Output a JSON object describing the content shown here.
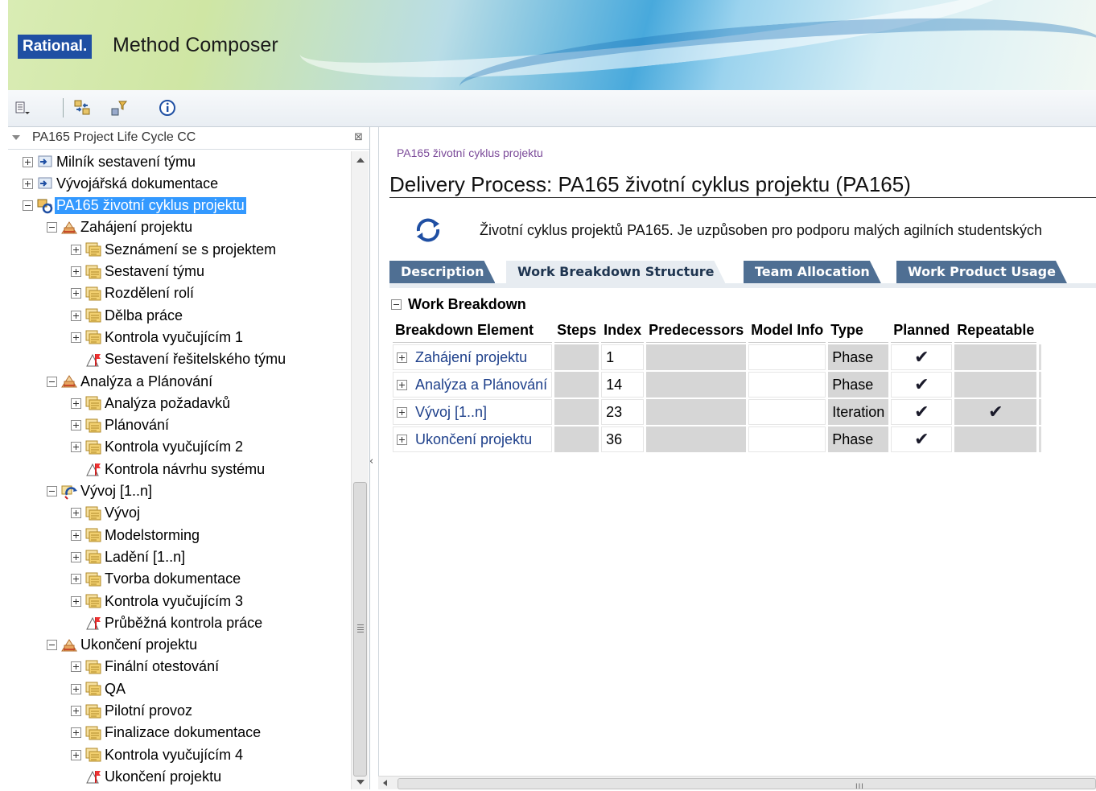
{
  "app": {
    "brand_badge": "Rational.",
    "product_name": "Method Composer"
  },
  "toolbar": {
    "buttons": [
      {
        "name": "view-menu-icon"
      },
      {
        "name": "link-with-editor-icon"
      },
      {
        "name": "filter-icon"
      },
      {
        "name": "info-icon"
      }
    ]
  },
  "library": {
    "title": "PA165 Project Life Cycle CC",
    "close_glyph": "⊠",
    "tree": [
      {
        "label": "Milník sestavení týmu",
        "level": 0,
        "type": "milestone",
        "expander": "plus"
      },
      {
        "label": "Vývojářská dokumentace",
        "level": 0,
        "type": "milestone",
        "expander": "plus"
      },
      {
        "label": "PA165 životní cyklus projektu",
        "level": 0,
        "type": "process",
        "expander": "minus",
        "selected": true
      },
      {
        "label": "Zahájení projektu",
        "level": 1,
        "type": "phase",
        "expander": "minus"
      },
      {
        "label": "Seznámení se s projektem",
        "level": 2,
        "type": "activity",
        "expander": "plus"
      },
      {
        "label": "Sestavení týmu",
        "level": 2,
        "type": "activity",
        "expander": "plus"
      },
      {
        "label": "Rozdělení rolí",
        "level": 2,
        "type": "activity",
        "expander": "plus"
      },
      {
        "label": "Dělba práce",
        "level": 2,
        "type": "activity",
        "expander": "plus"
      },
      {
        "label": "Kontrola vyučujícím 1",
        "level": 2,
        "type": "activity",
        "expander": "plus"
      },
      {
        "label": "Sestavení řešitelského týmu",
        "level": 2,
        "type": "milestone-flag",
        "expander": "none"
      },
      {
        "label": "Analýza a Plánování",
        "level": 1,
        "type": "phase",
        "expander": "minus"
      },
      {
        "label": "Analýza požadavků",
        "level": 2,
        "type": "activity",
        "expander": "plus"
      },
      {
        "label": "Plánování",
        "level": 2,
        "type": "activity",
        "expander": "plus"
      },
      {
        "label": "Kontrola vyučujícím 2",
        "level": 2,
        "type": "activity",
        "expander": "plus"
      },
      {
        "label": "Kontrola návrhu systému",
        "level": 2,
        "type": "milestone-flag",
        "expander": "none"
      },
      {
        "label": "Vývoj [1..n]",
        "level": 1,
        "type": "iteration",
        "expander": "minus"
      },
      {
        "label": "Vývoj",
        "level": 2,
        "type": "activity",
        "expander": "plus"
      },
      {
        "label": "Modelstorming",
        "level": 2,
        "type": "activity",
        "expander": "plus"
      },
      {
        "label": "Ladění [1..n]",
        "level": 2,
        "type": "activity",
        "expander": "plus"
      },
      {
        "label": "Tvorba dokumentace",
        "level": 2,
        "type": "activity",
        "expander": "plus"
      },
      {
        "label": "Kontrola vyučujícím 3",
        "level": 2,
        "type": "activity",
        "expander": "plus"
      },
      {
        "label": "Průběžná kontrola práce",
        "level": 2,
        "type": "milestone-flag",
        "expander": "none"
      },
      {
        "label": "Ukončení projektu",
        "level": 1,
        "type": "phase",
        "expander": "minus"
      },
      {
        "label": "Finální otestování",
        "level": 2,
        "type": "activity",
        "expander": "plus"
      },
      {
        "label": "QA",
        "level": 2,
        "type": "activity",
        "expander": "plus"
      },
      {
        "label": "Pilotní provoz",
        "level": 2,
        "type": "activity",
        "expander": "plus"
      },
      {
        "label": "Finalizace dokumentace",
        "level": 2,
        "type": "activity",
        "expander": "plus"
      },
      {
        "label": "Kontrola vyučujícím 4",
        "level": 2,
        "type": "activity",
        "expander": "plus"
      },
      {
        "label": "Ukončení projektu",
        "level": 2,
        "type": "milestone-flag",
        "expander": "none"
      }
    ]
  },
  "editor": {
    "breadcrumb": "PA165 životní cyklus projektu",
    "title": "Delivery Process: PA165 životní cyklus projektu (PA165)",
    "brief": "Životní cyklus projektů PA165. Je uzpůsoben pro podporu malých agilních studentských",
    "tabs": [
      {
        "label": "Description",
        "active": false
      },
      {
        "label": "Work Breakdown Structure",
        "active": true
      },
      {
        "label": "Team Allocation",
        "active": false
      },
      {
        "label": "Work Product Usage",
        "active": false
      }
    ],
    "section_title": "Work Breakdown",
    "table": {
      "columns": [
        "Breakdown Element",
        "Steps",
        "Index",
        "Predecessors",
        "Model Info",
        "Type",
        "Planned",
        "Repeatable"
      ],
      "rows": [
        {
          "name": "Zahájení projektu",
          "steps": "",
          "index": "1",
          "predecessors": "",
          "model_info": "",
          "type": "Phase",
          "planned": "✔",
          "repeatable": ""
        },
        {
          "name": "Analýza a Plánování",
          "steps": "",
          "index": "14",
          "predecessors": "",
          "model_info": "",
          "type": "Phase",
          "planned": "✔",
          "repeatable": ""
        },
        {
          "name": "Vývoj [1..n]",
          "steps": "",
          "index": "23",
          "predecessors": "",
          "model_info": "",
          "type": "Iteration",
          "planned": "✔",
          "repeatable": "✔"
        },
        {
          "name": "Ukončení projektu",
          "steps": "",
          "index": "36",
          "predecessors": "",
          "model_info": "",
          "type": "Phase",
          "planned": "✔",
          "repeatable": ""
        }
      ]
    }
  },
  "scroll": {
    "h_grip": "III"
  },
  "colors": {
    "badge": "#1f4fa3",
    "tab_inactive": "#4f6f93",
    "selection": "#3399ff",
    "link": "#1d3f8a",
    "breadcrumb": "#7b4a99"
  }
}
